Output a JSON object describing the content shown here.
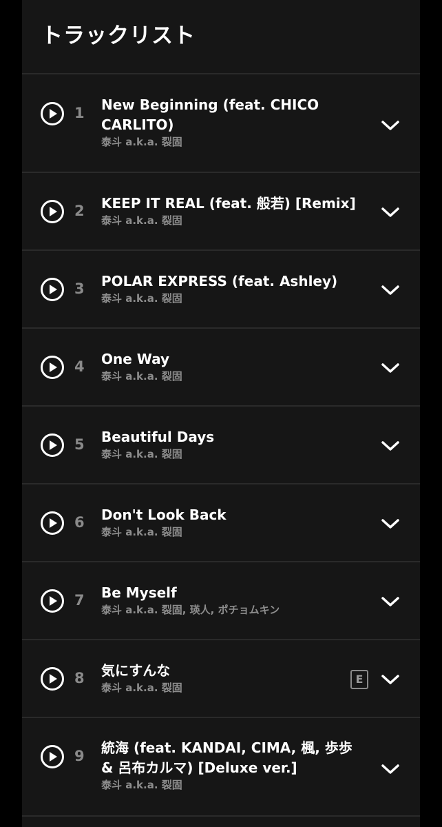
{
  "header": {
    "title": "トラックリスト"
  },
  "tracks": [
    {
      "number": "1",
      "title": "New Beginning (feat. CHICO CARLITO)",
      "artist": "泰斗 a.k.a. 裂固",
      "explicit": false
    },
    {
      "number": "2",
      "title": "KEEP IT REAL (feat. 般若) [Remix]",
      "artist": "泰斗 a.k.a. 裂固",
      "explicit": false
    },
    {
      "number": "3",
      "title": "POLAR EXPRESS (feat. Ashley)",
      "artist": "泰斗 a.k.a. 裂固",
      "explicit": false
    },
    {
      "number": "4",
      "title": "One Way",
      "artist": "泰斗 a.k.a. 裂固",
      "explicit": false
    },
    {
      "number": "5",
      "title": "Beautiful Days",
      "artist": "泰斗 a.k.a. 裂固",
      "explicit": false
    },
    {
      "number": "6",
      "title": "Don't Look Back",
      "artist": "泰斗 a.k.a. 裂固",
      "explicit": false
    },
    {
      "number": "7",
      "title": "Be Myself",
      "artist": "泰斗 a.k.a. 裂固, 瑛人, ポチョムキン",
      "explicit": false
    },
    {
      "number": "8",
      "title": "気にすんな",
      "artist": "泰斗 a.k.a. 裂固",
      "explicit": true,
      "explicit_label": "E"
    },
    {
      "number": "9",
      "title": "統海 (feat. KANDAI, CIMA, 楓, 歩歩 & 呂布カルマ) [Deluxe ver.]",
      "artist": "泰斗 a.k.a. 裂固",
      "explicit": false
    }
  ],
  "icons": {
    "play": "play-circle-icon",
    "expand": "chevron-down-icon"
  },
  "colors": {
    "background": "#000000",
    "panel": "#161616",
    "divider": "#2a2a2a",
    "title_text": "#ffffff",
    "secondary_text": "#8d8d8d"
  }
}
